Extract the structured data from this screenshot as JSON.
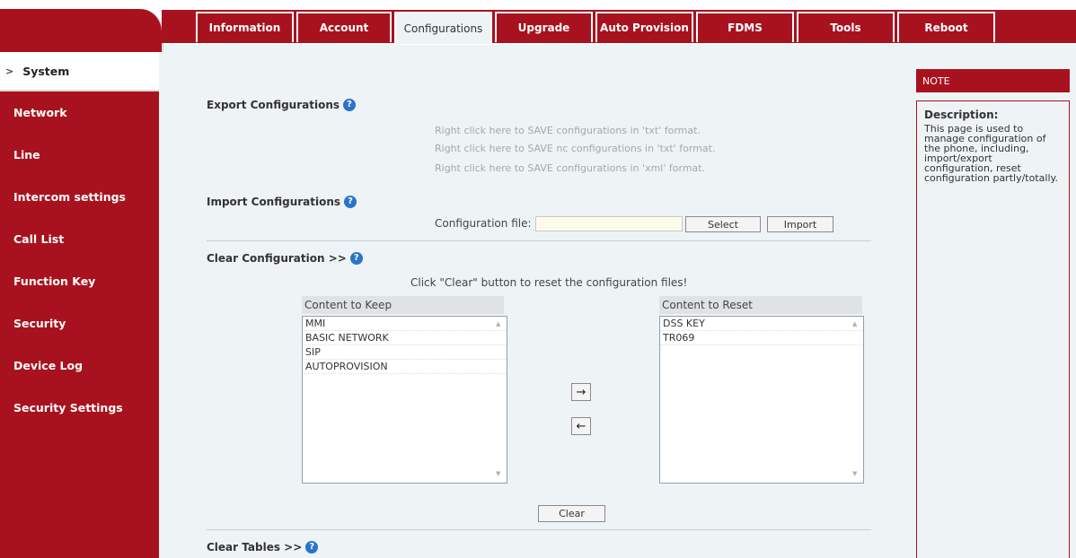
{
  "tabs": [
    {
      "label": "Information",
      "active": false
    },
    {
      "label": "Account",
      "active": false
    },
    {
      "label": "Configurations",
      "active": true
    },
    {
      "label": "Upgrade",
      "active": false
    },
    {
      "label": "Auto Provision",
      "active": false
    },
    {
      "label": "FDMS",
      "active": false
    },
    {
      "label": "Tools",
      "active": false
    },
    {
      "label": "Reboot",
      "active": false
    }
  ],
  "sidebar": {
    "items": [
      {
        "label": "System",
        "active": true
      },
      {
        "label": "Network"
      },
      {
        "label": "Line"
      },
      {
        "label": "Intercom settings"
      },
      {
        "label": "Call List"
      },
      {
        "label": "Function Key"
      },
      {
        "label": "Security"
      },
      {
        "label": "Device Log"
      },
      {
        "label": "Security Settings"
      }
    ]
  },
  "export": {
    "title": "Export Configurations",
    "links": [
      "Right click here to SAVE configurations in 'txt' format.",
      "Right click here to SAVE nc configurations in 'txt' format.",
      "Right click here to SAVE configurations in 'xml' format."
    ]
  },
  "import": {
    "title": "Import Configurations",
    "file_label": "Configuration file:",
    "file_value": "",
    "select_label": "Select",
    "import_label": "Import"
  },
  "clear_config": {
    "title": "Clear Configuration >>",
    "hint": "Click \"Clear\" button to reset the configuration files!",
    "keep_header": "Content to Keep",
    "keep_items": [
      "MMI",
      "BASIC NETWORK",
      "SIP",
      "AUTOPROVISION"
    ],
    "reset_header": "Content to Reset",
    "reset_items": [
      "DSS KEY",
      "TR069"
    ],
    "move_right": "→",
    "move_left": "←",
    "clear_label": "Clear"
  },
  "clear_tables": {
    "title": "Clear Tables >>"
  },
  "note": {
    "header": "NOTE",
    "title": "Description:",
    "text": "This page is used to manage configuration of the phone, including, import/export configuration, reset configuration partly/totally."
  },
  "help_glyph": "?",
  "colors": {
    "brand_red": "#a8121f",
    "help_blue": "#2a74c9",
    "background": "#eef3f5"
  }
}
